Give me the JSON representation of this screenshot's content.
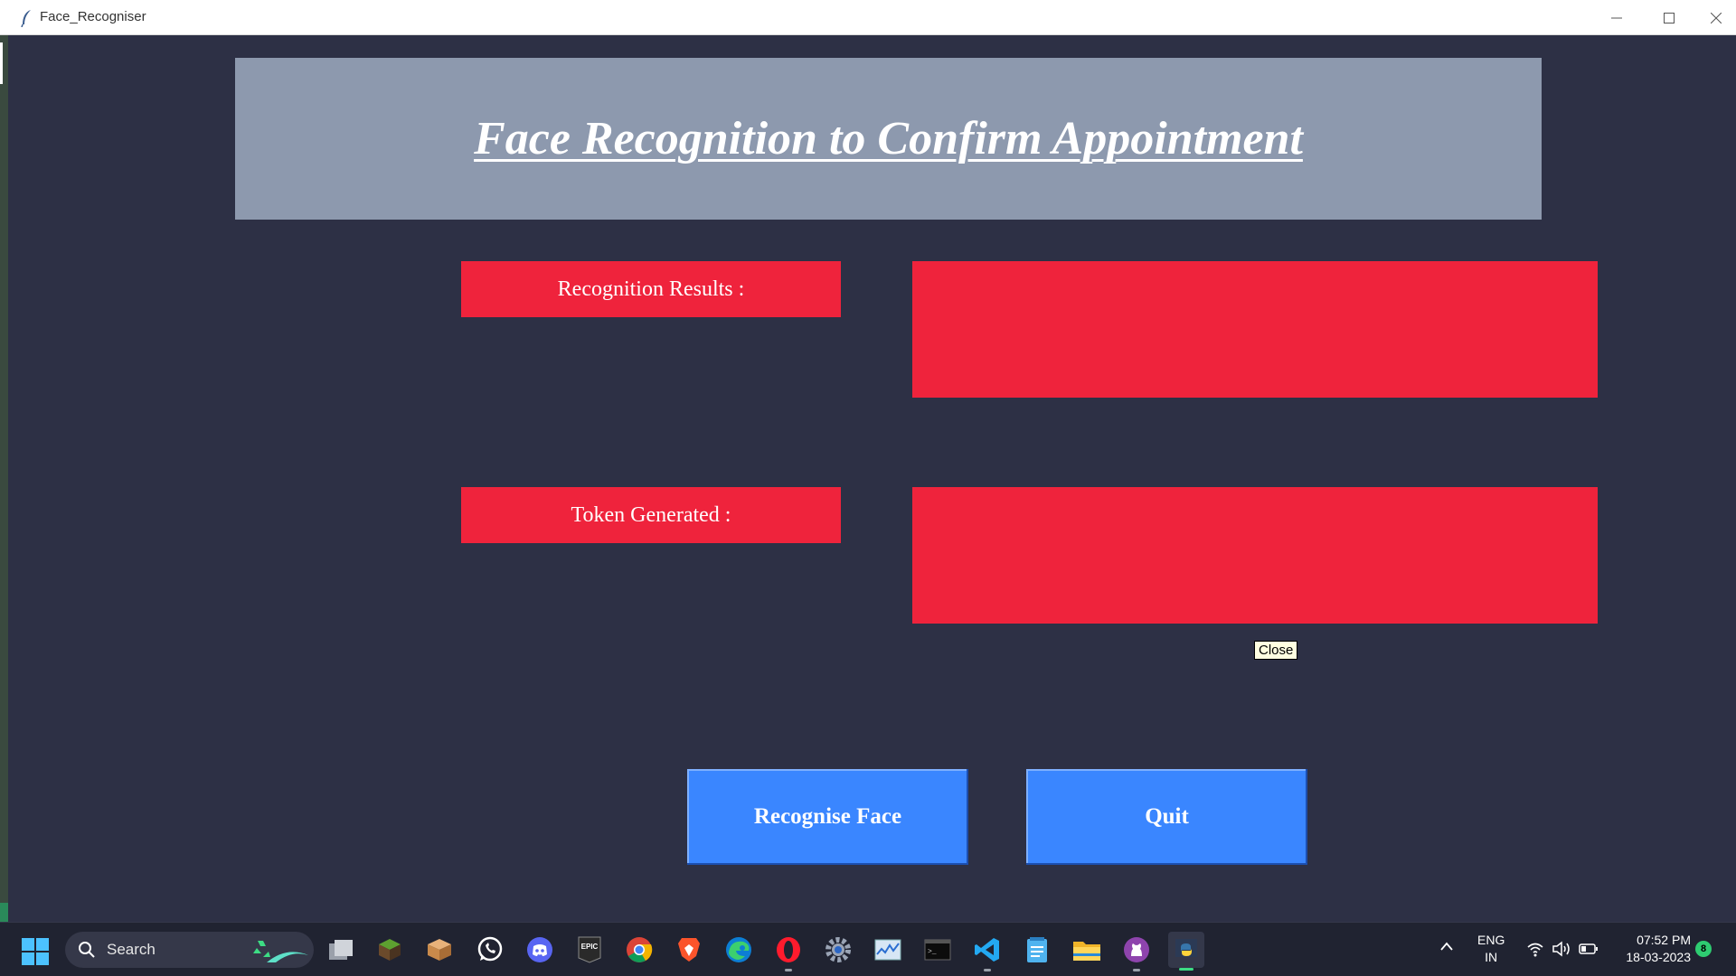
{
  "window": {
    "title": "Face_Recogniser",
    "controls": [
      "minimize",
      "maximize",
      "close"
    ]
  },
  "app": {
    "heading": "Face Recognition to Confirm Appointment",
    "results_label": "Recognition Results :",
    "results_value": "",
    "token_label": "Token Generated :",
    "token_value": "",
    "tooltip": "Close",
    "recognise_button": "Recognise Face",
    "quit_button": "Quit"
  },
  "colors": {
    "background": "#2d3045",
    "header_panel": "#8d99ae",
    "label_red": "#ef233c",
    "button_blue": "#3a86ff"
  },
  "taskbar": {
    "search_placeholder": "Search",
    "apps": [
      "task-view",
      "minecraft",
      "package-app",
      "whatsapp",
      "discord",
      "epic-games",
      "chrome",
      "brave",
      "edge",
      "opera",
      "settings",
      "resource-monitor",
      "terminal",
      "vscode",
      "notepad",
      "file-explorer",
      "github-desktop",
      "python"
    ],
    "language_line1": "ENG",
    "language_line2": "IN",
    "time": "07:52 PM",
    "date": "18-03-2023",
    "notification_count": "8"
  }
}
